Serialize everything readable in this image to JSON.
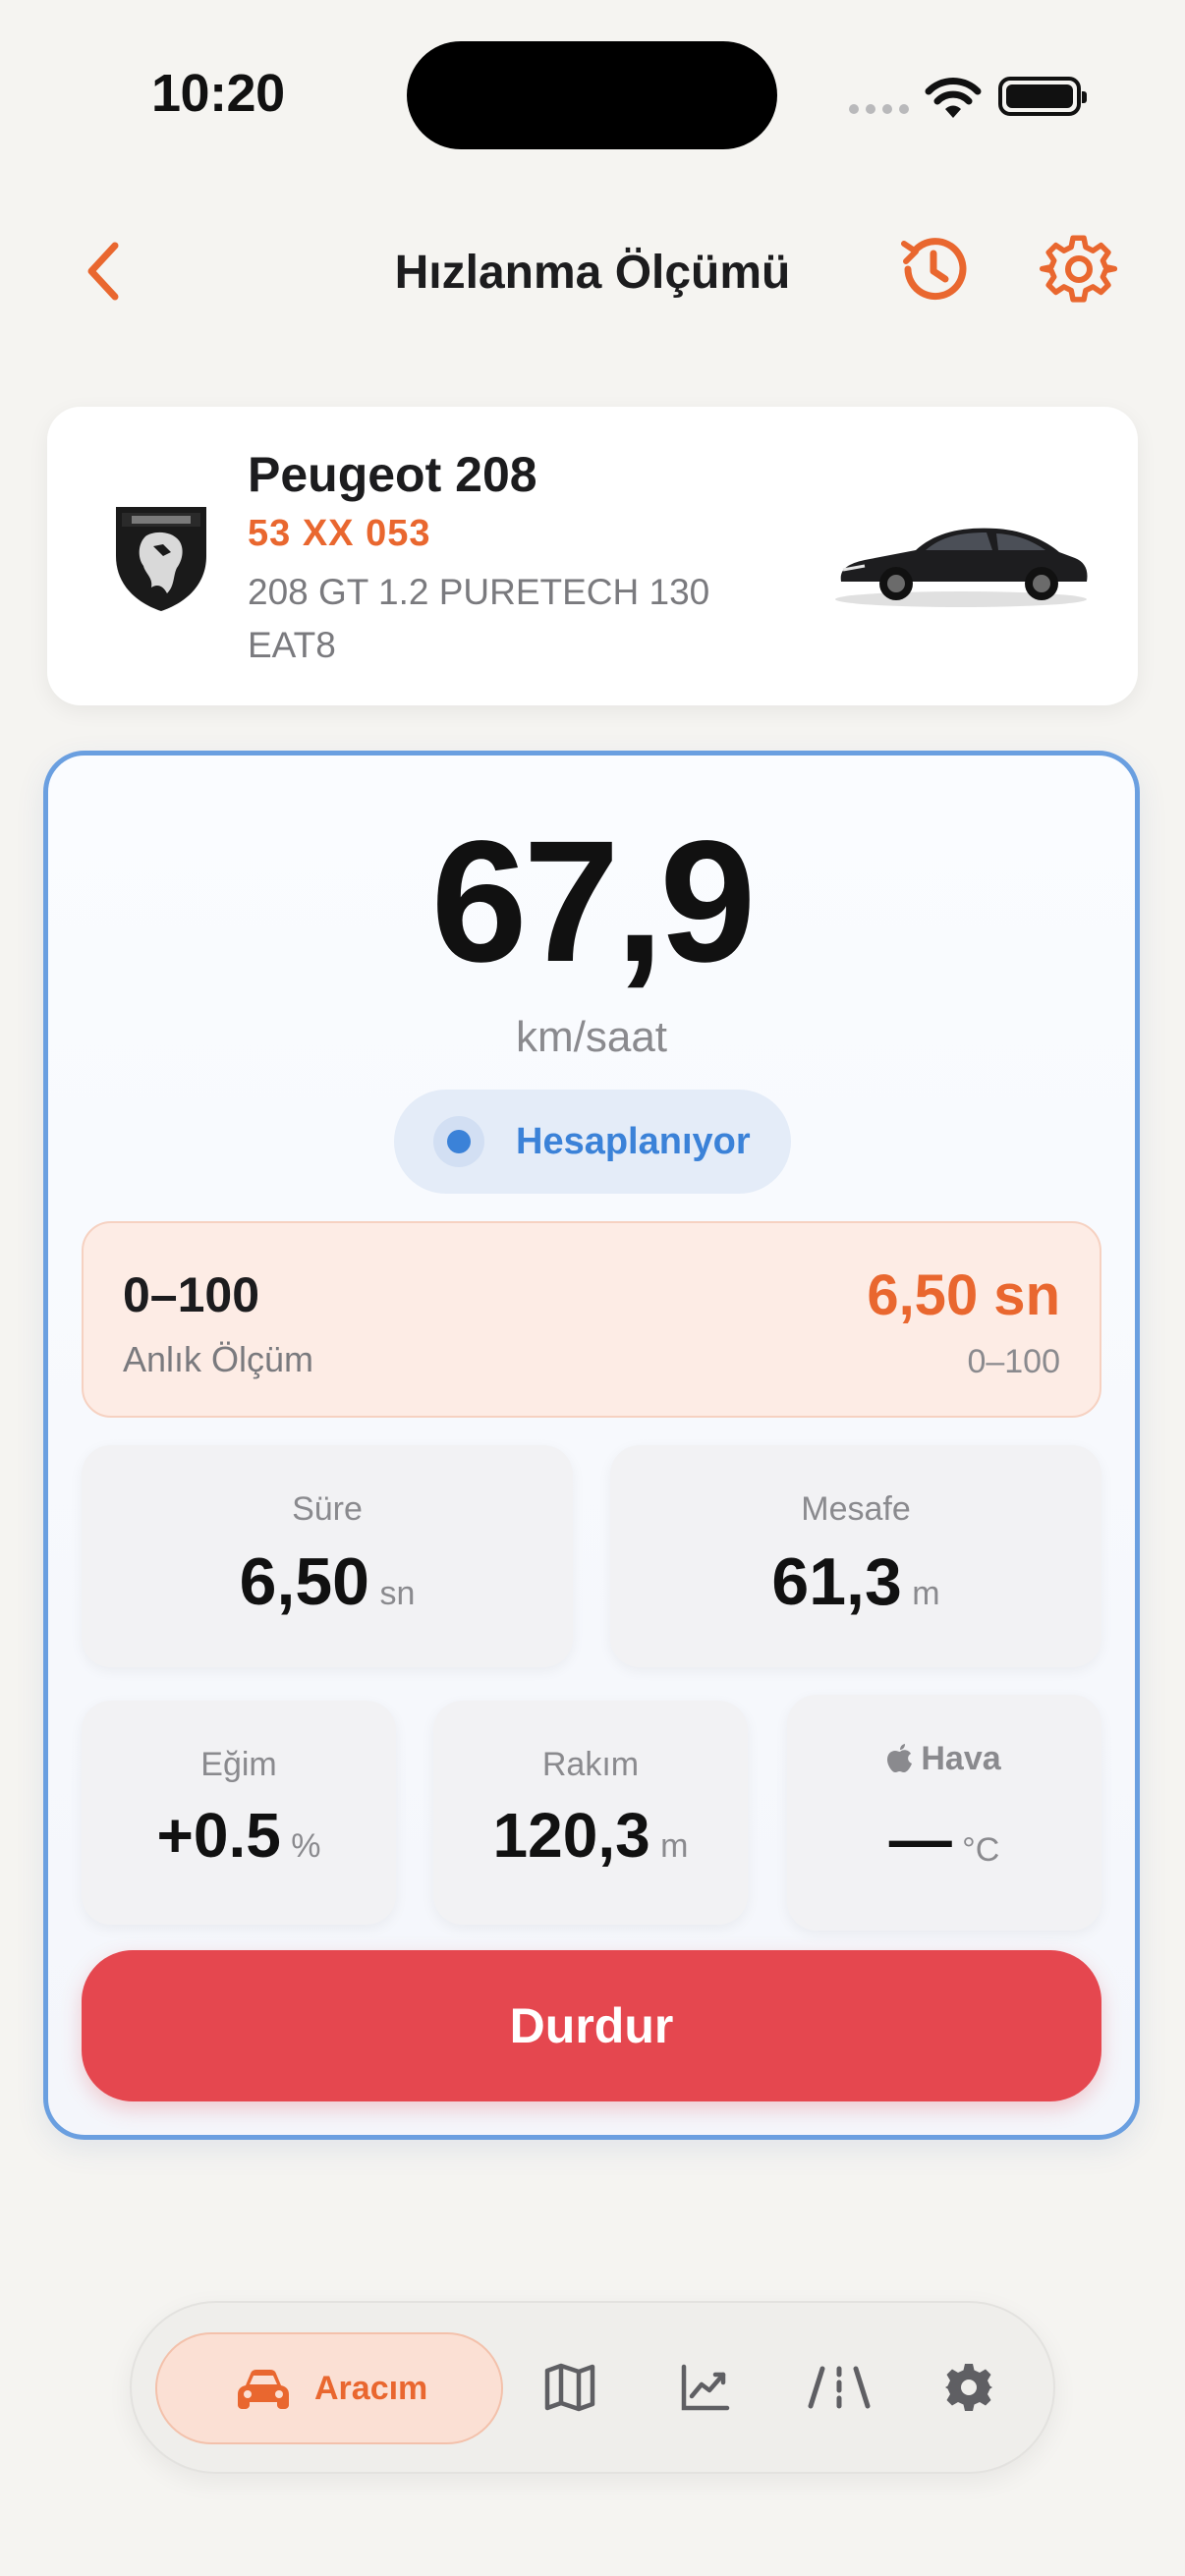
{
  "status_bar": {
    "time": "10:20"
  },
  "header": {
    "title": "Hızlanma Ölçümü"
  },
  "vehicle": {
    "brand_logo": "peugeot-lion-logo",
    "name": "Peugeot 208",
    "plate": "53 XX 053",
    "model": "208 GT 1.2 PURETECH 130 EAT8"
  },
  "measurement": {
    "speed": "67,9",
    "speed_unit": "km/saat",
    "status": "Hesaplanıyor",
    "result": {
      "range": "0–100",
      "caption": "Anlık Ölçüm",
      "time": "6,50 sn",
      "range_sub": "0–100"
    },
    "duration": {
      "label": "Süre",
      "value": "6,50",
      "unit": "sn"
    },
    "distance": {
      "label": "Mesafe",
      "value": "61,3",
      "unit": "m"
    },
    "slope": {
      "label": "Eğim",
      "value": "+0.5",
      "unit": "%"
    },
    "altitude": {
      "label": "Rakım",
      "value": "120,3",
      "unit": "m"
    },
    "weather": {
      "label": "Hava",
      "value": "—",
      "unit": "°C"
    },
    "stop_label": "Durdur"
  },
  "tab_bar": {
    "active_label": "Aracım",
    "items": [
      "car-icon",
      "map-icon",
      "chart-icon",
      "road-icon",
      "gear-icon"
    ]
  },
  "colors": {
    "accent": "#e9672f",
    "primary_blue": "#3b82d8",
    "stop_red": "#e5474f",
    "background": "#f5f4f1"
  }
}
